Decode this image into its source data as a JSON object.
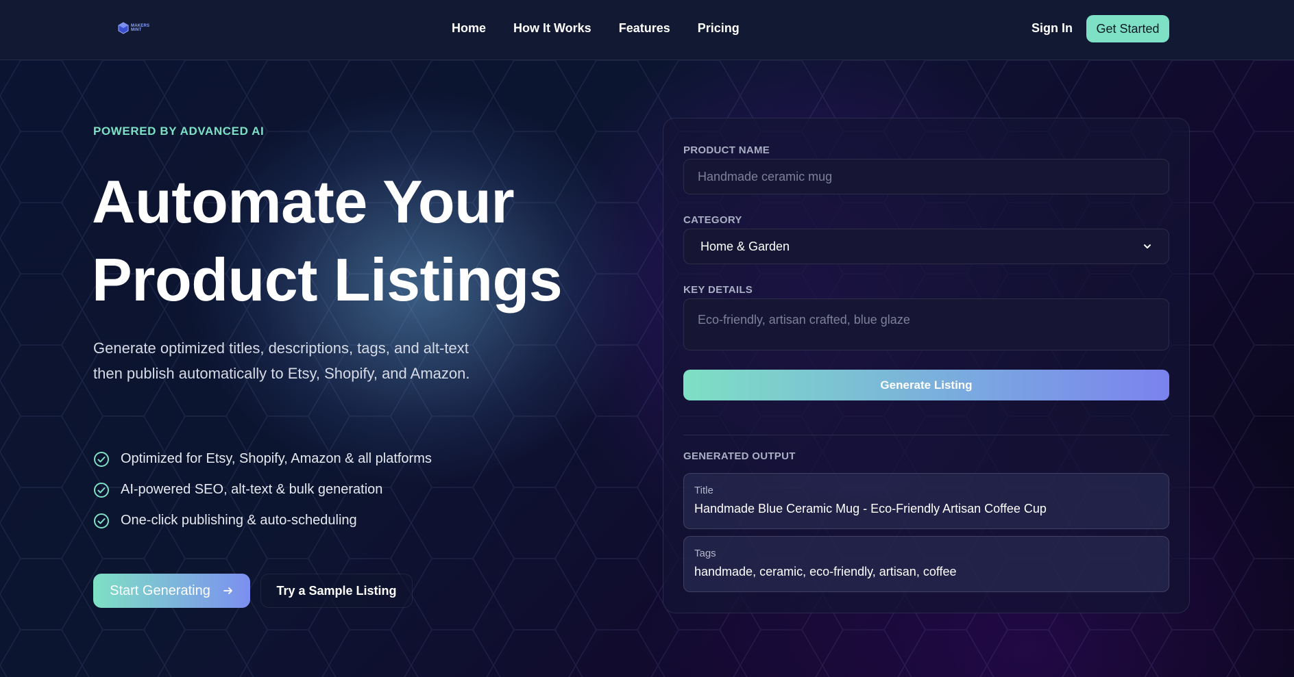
{
  "nav": {
    "logo_text": "MAKERS MINT",
    "links": [
      "Home",
      "How It Works",
      "Features",
      "Pricing"
    ],
    "sign_in": "Sign In",
    "get_started": "Get Started"
  },
  "hero": {
    "eyebrow": "POWERED BY ADVANCED AI",
    "headline_line1": "Automate Your",
    "headline_line2": "Product Listings",
    "subhead": "Generate optimized titles, descriptions, tags, and alt-text then publish automatically to Etsy, Shopify, and Amazon.",
    "features": [
      "Optimized for Etsy, Shopify, Amazon & all platforms",
      "AI-powered SEO, alt-text & bulk generation",
      "One-click publishing & auto-scheduling"
    ],
    "start_button": "Start Generating",
    "sample_button": "Try a Sample Listing"
  },
  "form": {
    "product_name_label": "PRODUCT NAME",
    "product_name_placeholder": "Handmade ceramic mug",
    "category_label": "CATEGORY",
    "category_value": "Home & Garden",
    "key_details_label": "KEY DETAILS",
    "key_details_placeholder": "Eco-friendly, artisan crafted, blue glaze",
    "generate_button": "Generate Listing",
    "output_heading": "GENERATED OUTPUT",
    "output_title_label": "Title",
    "output_title_value": "Handmade Blue Ceramic Mug - Eco-Friendly Artisan Coffee Cup",
    "output_tags_label": "Tags",
    "output_tags_value": "handmade, ceramic, eco-friendly, artisan, coffee"
  },
  "colors": {
    "accent": "#7ee0c4",
    "accent_end": "#7c8ff0",
    "card_bg": "#141434",
    "nav_bg": "#121a33"
  }
}
